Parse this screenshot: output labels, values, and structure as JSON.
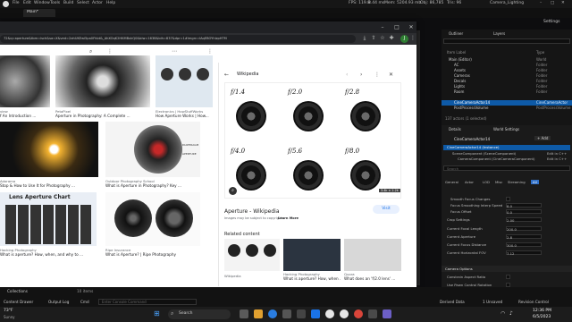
{
  "ue": {
    "menu": [
      "File",
      "Edit",
      "Window",
      "Tools",
      "Build",
      "Select",
      "Actor",
      "Help"
    ],
    "doc_tab": "Main*",
    "stats": [
      "FPS: 119.8",
      "8.44 ms",
      "Mem: 5204.93 mb",
      "Obj: 86,785",
      "Tris: 96"
    ],
    "project": "Camera_Lighting",
    "settings_label": "Settings",
    "outliner": {
      "tab": "Outliner",
      "layers_tab": "Layers",
      "col_label": "Item Label",
      "col_type": "Type",
      "rows": [
        {
          "label": "Main (Editor)",
          "type": "World"
        },
        {
          "label": "AC",
          "type": "Folder"
        },
        {
          "label": "Assets",
          "type": "Folder"
        },
        {
          "label": "Cameras",
          "type": "Folder"
        },
        {
          "label": "Decals",
          "type": "Folder"
        },
        {
          "label": "Lights",
          "type": "Folder"
        },
        {
          "label": "Room",
          "type": "Folder"
        },
        {
          "label": "CineCameraActor14",
          "type": "CineCameraActor"
        },
        {
          "label": "PostProcessVolume",
          "type": "PostProcessVolume"
        }
      ],
      "footer": "137 actors (1 selected)"
    },
    "details": {
      "tab": "Details",
      "world_settings": "World Settings",
      "actor_name": "CineCameraActor14",
      "add_label": "+ Add",
      "components": [
        "CineCameraActor14 (Instance)",
        "SceneComponent (SceneComponent)",
        "CameraComponent (CineCameraComponent)"
      ],
      "edit_in_cpp": "Edit in C++",
      "search_placeholder": "Search",
      "filter_tabs": [
        "General",
        "Actor",
        "LOD",
        "Misc",
        "Streaming",
        "All"
      ],
      "rows": [
        {
          "label": "Smooth Focus Changes",
          "value": ""
        },
        {
          "label": "Focus Smoothing Interp Speed",
          "value": "8.0"
        },
        {
          "label": "Focus Offset",
          "value": "0.0"
        },
        {
          "label": "Crop Settings",
          "value": "2.00"
        },
        {
          "label": "Current Focal Length",
          "value": "200.0"
        },
        {
          "label": "Current Aperture",
          "value": "2.8"
        },
        {
          "label": "Current Focus Distance",
          "value": "300.0"
        },
        {
          "label": "Current Horizontal FOV",
          "value": "7.12"
        },
        {
          "label": "Camera Options",
          "value": ""
        },
        {
          "label": "Constrain Aspect Ratio",
          "value": ""
        },
        {
          "label": "Use Pawn Control Rotation",
          "value": ""
        },
        {
          "label": "Post Process Blend Weight",
          "value": "1.0"
        }
      ]
    },
    "bottom": {
      "collections": "Collections",
      "items": "10 items",
      "bar": [
        "Content Drawer",
        "Output Log",
        "Cmd",
        "Enter Console Command",
        "Derived Data",
        "1 Unsaved",
        "Revision Control"
      ]
    }
  },
  "browser": {
    "url": "72&q=aperture&tbm=isch&sa=X&ved=2ahUKEwi5pa0Fhbt&_AhXOqK2HKMBxkQ0&biw=1638&bih=837&dpr=1#imgrc=IAqEBOYhlzpHTM",
    "results": [
      {
        "src": "view",
        "title": "f An Introduction ..."
      },
      {
        "src": "PetaPixel",
        "title": "Aperture in Photography: A Complete ..."
      },
      {
        "src": "Electronics | HowStuffWorks",
        "title": "How Aperture Works | How..."
      },
      {
        "src": "Adorama",
        "title": "Stop & How to Use It for Photography ..."
      },
      {
        "src": "Outdoor Photography School",
        "title": "What is Aperture in Photography? Key ..."
      },
      {
        "src": "Hacking Photography",
        "title": "What is aperture? How, when, and why to ..."
      },
      {
        "src": "Ripe Insurance",
        "title": "What is Aperture? | Ripe Photography"
      }
    ],
    "chart_labels": [
      "DIAPHRAGM",
      "APERTURE"
    ],
    "lens_chart_title": "Lens Aperture Chart"
  },
  "panel": {
    "source": "Wikipedia",
    "fstops": [
      "f/1.4",
      "f/2.0",
      "f/2.8",
      "f/4.0",
      "f/5.6",
      "f/8.0"
    ],
    "size_badge": "3.4k × 2.2k",
    "title": "Aperture - Wikipedia",
    "visit": "Visit",
    "note": "Images may be subject to copyright.",
    "learn_more": "Learn More",
    "related": "Related content",
    "related_items": [
      {
        "src": "Wikipedia",
        "title": ""
      },
      {
        "src": "Hacking Photography",
        "title": "What is aperture? How, when ..."
      },
      {
        "src": "Quora",
        "title": "What does an 'f/2.0 lens' ..."
      }
    ]
  },
  "taskbar": {
    "weather_temp": "73°F",
    "weather_cond": "Sunny",
    "search": "Search",
    "time": "12:36 PM",
    "date": "6/5/2023"
  }
}
